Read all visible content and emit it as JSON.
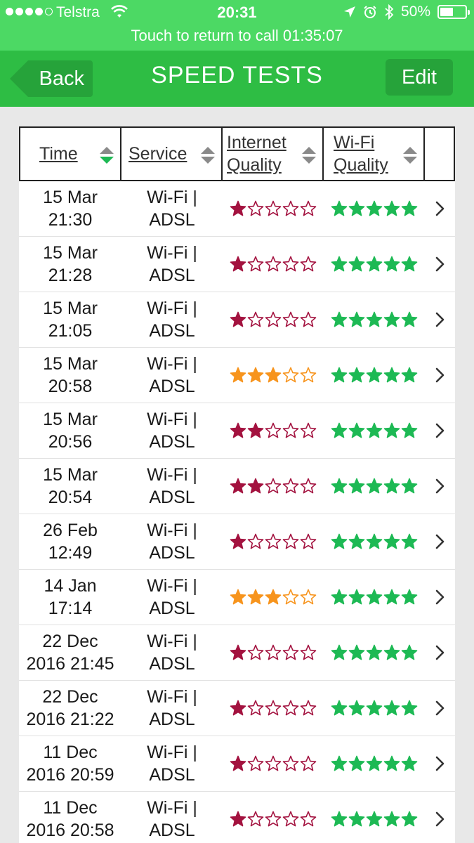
{
  "status": {
    "carrier": "Telstra",
    "time": "20:31",
    "battery": "50%",
    "battery_level": 0.5,
    "call_banner": "Touch to return to call 01:35:07"
  },
  "nav": {
    "back_label": "Back",
    "title": "SPEED TESTS",
    "edit_label": "Edit"
  },
  "table": {
    "headers": {
      "time": "Time",
      "service": "Service",
      "internet_quality": [
        "Internet",
        "Quality"
      ],
      "wifi_quality": [
        "Wi-Fi",
        "Quality"
      ]
    },
    "rows": [
      {
        "time": [
          "15 Mar",
          "21:30"
        ],
        "service": [
          "Wi-Fi |",
          "ADSL"
        ],
        "internet": 1,
        "wifi": 5
      },
      {
        "time": [
          "15 Mar",
          "21:28"
        ],
        "service": [
          "Wi-Fi |",
          "ADSL"
        ],
        "internet": 1,
        "wifi": 5
      },
      {
        "time": [
          "15 Mar",
          "21:05"
        ],
        "service": [
          "Wi-Fi |",
          "ADSL"
        ],
        "internet": 1,
        "wifi": 5
      },
      {
        "time": [
          "15 Mar",
          "20:58"
        ],
        "service": [
          "Wi-Fi |",
          "ADSL"
        ],
        "internet": 3,
        "wifi": 5
      },
      {
        "time": [
          "15 Mar",
          "20:56"
        ],
        "service": [
          "Wi-Fi |",
          "ADSL"
        ],
        "internet": 2,
        "wifi": 5
      },
      {
        "time": [
          "15 Mar",
          "20:54"
        ],
        "service": [
          "Wi-Fi |",
          "ADSL"
        ],
        "internet": 2,
        "wifi": 5
      },
      {
        "time": [
          "26 Feb",
          "12:49"
        ],
        "service": [
          "Wi-Fi |",
          "ADSL"
        ],
        "internet": 1,
        "wifi": 5
      },
      {
        "time": [
          "14 Jan",
          "17:14"
        ],
        "service": [
          "Wi-Fi |",
          "ADSL"
        ],
        "internet": 3,
        "wifi": 5
      },
      {
        "time": [
          "22 Dec",
          "2016 21:45"
        ],
        "service": [
          "Wi-Fi |",
          "ADSL"
        ],
        "internet": 1,
        "wifi": 5
      },
      {
        "time": [
          "22 Dec",
          "2016 21:22"
        ],
        "service": [
          "Wi-Fi |",
          "ADSL"
        ],
        "internet": 1,
        "wifi": 5
      },
      {
        "time": [
          "11 Dec",
          "2016 20:59"
        ],
        "service": [
          "Wi-Fi |",
          "ADSL"
        ],
        "internet": 1,
        "wifi": 5
      },
      {
        "time": [
          "11 Dec",
          "2016 20:58"
        ],
        "service": [
          "Wi-Fi |",
          "ADSL"
        ],
        "internet": 1,
        "wifi": 5
      }
    ]
  },
  "colors": {
    "status_bar": "#4cd964",
    "nav_bar": "#2ebd44",
    "button": "#26a33a",
    "star_poor": "#a3123f",
    "star_fair": "#f7941d",
    "star_wifi": "#1db954"
  },
  "icons": {
    "signal": "signal-dots-icon",
    "wifi": "wifi-icon",
    "location": "location-arrow-icon",
    "alarm": "alarm-icon",
    "bluetooth": "bluetooth-icon",
    "battery": "battery-icon",
    "sort": "sort-arrows-icon",
    "star": "star-icon",
    "chevron": "chevron-right-icon"
  }
}
